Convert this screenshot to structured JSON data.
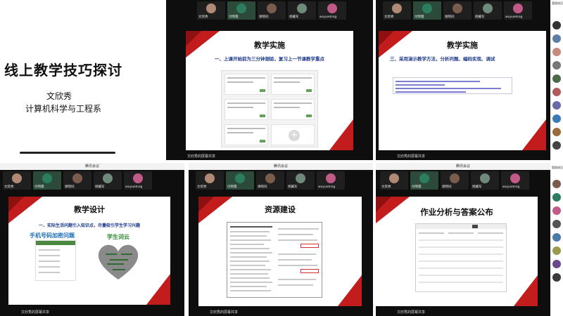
{
  "title_slide": {
    "title": "线上教学技巧探讨",
    "author": "文欣秀",
    "department": "计算机科学与工程系"
  },
  "window_title": "腾讯会议",
  "share_label": "文欣秀的屏幕共享",
  "participants": [
    "文欣秀",
    "付明霞",
    "谢晓同",
    "杨翼军",
    "wuyuelling"
  ],
  "side_label": "管理成员",
  "colors": {
    "accent_red": "#c31c1c",
    "dark": "#0e0e0e",
    "subtitle_blue": "#1d3a8a",
    "ok_green": "#66a15a"
  },
  "slides": {
    "s1": {
      "title": "教学实施",
      "subtitle": "一、上课开始前为三分钟测验，复习上一节课教学重点"
    },
    "s2": {
      "title": "教学实施",
      "subtitle": "三、采用演示教学方法，分析问题、编码实现、调试"
    },
    "s3": {
      "title": "教学设计",
      "subtitle": "一、实际生活问题引入知识点，尽量吸引学生学习兴趣",
      "box_left": "手机号码加密问题",
      "box_right": "学生词云"
    },
    "s4": {
      "title": "资源建设"
    },
    "s5": {
      "title": "作业分析与答案公布"
    }
  }
}
